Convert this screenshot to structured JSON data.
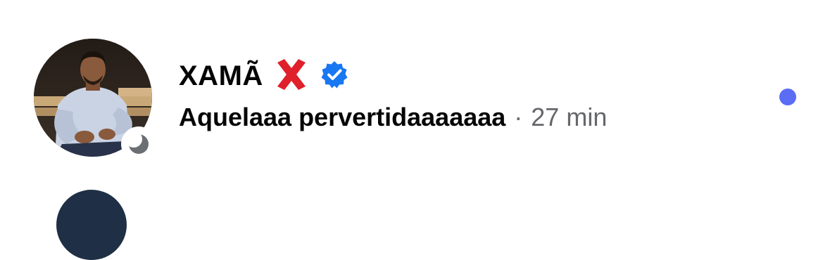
{
  "conversation": {
    "name": "XAMÃ",
    "message": "Aquelaaa pervertidaaaaaaa",
    "separator": "·",
    "time": "27 min",
    "unread": true,
    "colors": {
      "unread_dot": "#5b6df5",
      "verified_badge": "#1877f2",
      "cross_mark": "#e0202a",
      "secondary_text": "#65676b"
    },
    "icons": [
      "cross-mark-icon",
      "verified-badge-icon",
      "moon-status-icon"
    ]
  }
}
